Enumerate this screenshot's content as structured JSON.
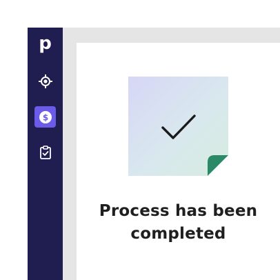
{
  "sidebar": {
    "logo_text": "p",
    "items": [
      {
        "name": "target-icon"
      },
      {
        "name": "dollar-icon",
        "active": true
      },
      {
        "name": "clipboard-check-icon"
      }
    ]
  },
  "main": {
    "illustration_icon": "checkmark-icon",
    "message_lines": [
      "Process has been",
      "completed"
    ]
  },
  "colors": {
    "sidebar_bg": "#201d50",
    "active_item_bg": "#6b5be9",
    "page_bg": "#e5e5e5",
    "panel_bg": "#ffffff",
    "fold_corner": "#2a8a68"
  }
}
